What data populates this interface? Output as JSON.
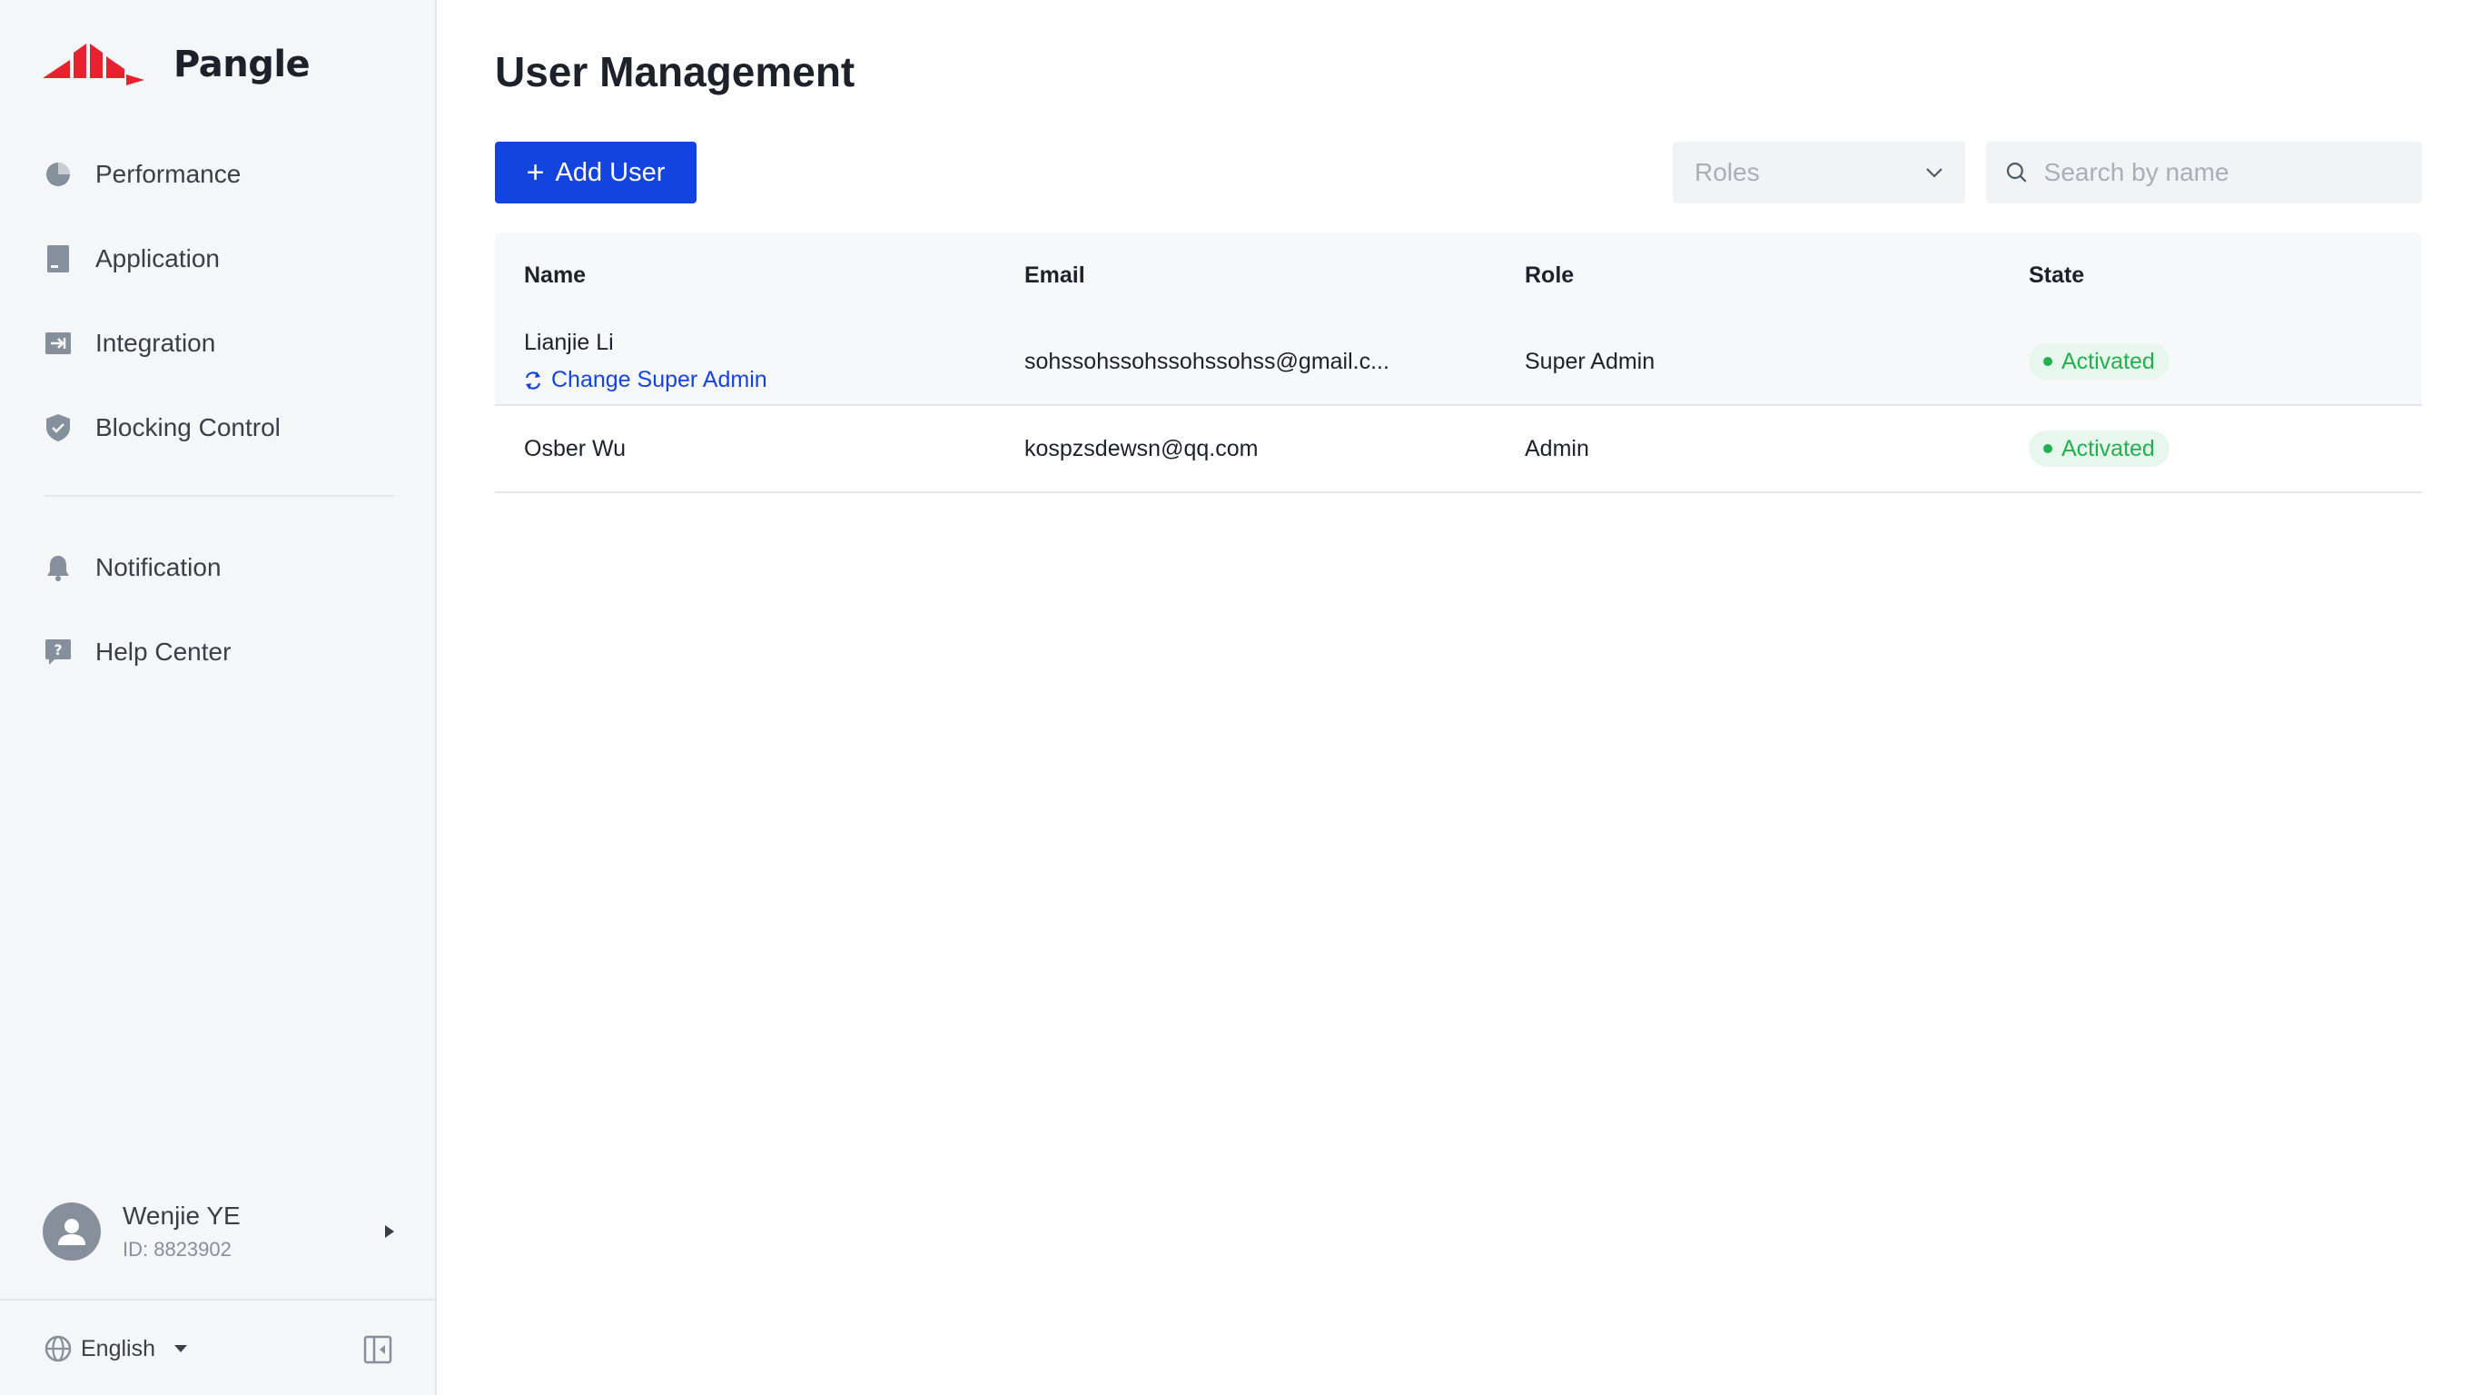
{
  "app": {
    "logo_text": "Pangle",
    "brand_color": "#e8212f"
  },
  "sidebar": {
    "primary_items": [
      {
        "label": "Performance",
        "icon": "pie-chart-icon"
      },
      {
        "label": "Application",
        "icon": "document-icon"
      },
      {
        "label": "Integration",
        "icon": "integration-icon"
      },
      {
        "label": "Blocking Control",
        "icon": "shield-icon"
      }
    ],
    "secondary_items": [
      {
        "label": "Notification",
        "icon": "bell-icon"
      },
      {
        "label": "Help Center",
        "icon": "help-icon"
      }
    ],
    "user": {
      "name": "Wenjie YE",
      "id": "ID: 8823902"
    },
    "language": "English"
  },
  "main": {
    "title": "User Management",
    "add_button_label": "Add User",
    "roles_placeholder": "Roles",
    "search_placeholder": "Search by name",
    "accent_color": "#1344e0",
    "table": {
      "columns": [
        "Name",
        "Email",
        "Role",
        "State"
      ],
      "rows": [
        {
          "name": "Lianjie Li",
          "action": "Change Super Admin",
          "email": "sohssohssohssohssohss@gmail.c...",
          "role": "Super Admin",
          "state": "Activated"
        },
        {
          "name": "Osber Wu",
          "email": "kospzsdewsn@qq.com",
          "role": "Admin",
          "state": "Activated"
        }
      ]
    }
  }
}
